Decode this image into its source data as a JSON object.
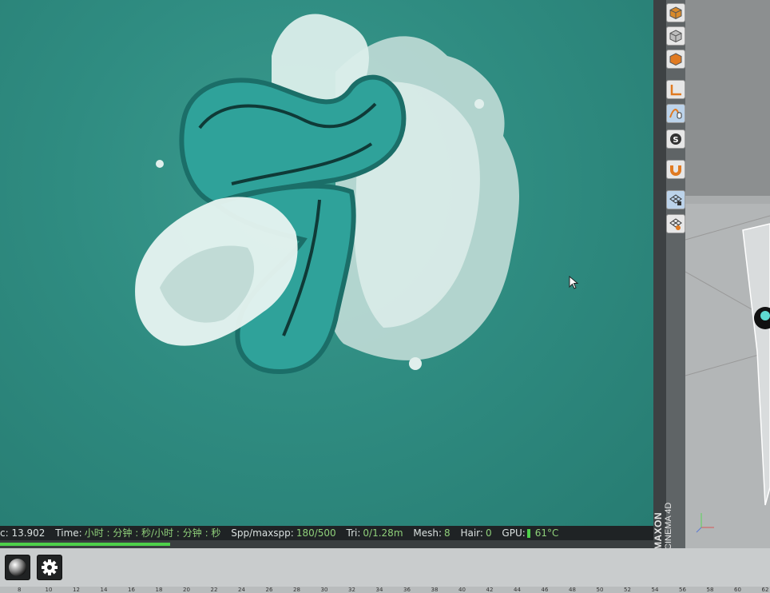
{
  "status": {
    "sec": "c: 13.902",
    "time_label": "Time:",
    "time_value": "小时 : 分钟 : 秒/小时 : 分钟 : 秒",
    "spp_label": "Spp/maxspp:",
    "spp_value": "180/500",
    "tri_label": "Tri:",
    "tri_value": "0/1.28m",
    "mesh_label": "Mesh:",
    "mesh_value": "8",
    "hair_label": "Hair:",
    "hair_value": "0",
    "gpu_label": "GPU:",
    "gpu_temp": "61°C",
    "progress": 0.26
  },
  "brand": {
    "maxon": "MAXON",
    "product": "CINEMA 4D"
  },
  "timeline": {
    "ticks": [
      "8",
      "10",
      "12",
      "14",
      "16",
      "18",
      "20",
      "22",
      "24",
      "26",
      "28",
      "30",
      "32",
      "34",
      "36",
      "38",
      "40",
      "42",
      "44",
      "46",
      "48",
      "50",
      "52",
      "54",
      "56",
      "58",
      "60",
      "62"
    ]
  },
  "icons": {
    "tools": [
      "cube-icon",
      "cube-outline-icon",
      "cube-solid-icon",
      "axis-icon",
      "spline-icon",
      "s-icon",
      "magnet-icon",
      "grid-lock-icon",
      "grid-flame-icon"
    ],
    "toolbar": [
      "material-sphere-icon",
      "settings-gear-icon"
    ]
  },
  "colors": {
    "viewport_bg": "#2f8c81",
    "logo_teal": "#2fa29a",
    "status_value": "#8fd07a",
    "progress": "#4ed04a"
  }
}
